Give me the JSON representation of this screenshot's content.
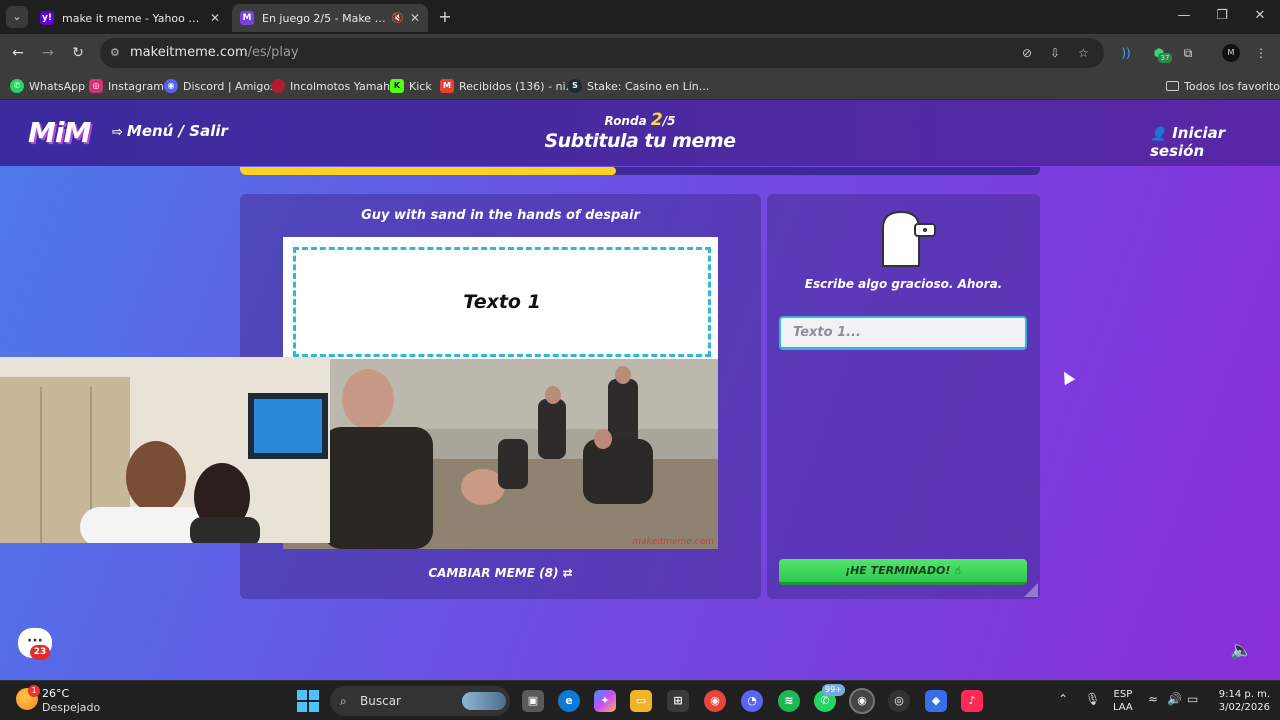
{
  "browser": {
    "tabs": [
      {
        "title": "make it meme - Yahoo Search R",
        "favicon": "yahoo-icon"
      },
      {
        "title": "En juego 2/5 - Make it Meme",
        "favicon": "mim-icon"
      }
    ],
    "url_host": "makeitmeme.com",
    "url_path": "/es/play",
    "bookmarks": [
      {
        "label": "WhatsApp",
        "icon": "whatsapp-icon"
      },
      {
        "label": "Instagram",
        "icon": "instagram-icon"
      },
      {
        "label": "Discord | Amigos",
        "icon": "discord-icon"
      },
      {
        "label": "Incolmotos Yamaha",
        "icon": "yamaha-icon"
      },
      {
        "label": "Kick",
        "icon": "kick-icon"
      },
      {
        "label": "Recibidos (136) - ni...",
        "icon": "gmail-icon"
      },
      {
        "label": "Stake: Casino en Lín...",
        "icon": "stake-icon"
      }
    ],
    "all_bookmarks": "Todos los favoritos",
    "extension_badge": "37"
  },
  "game": {
    "logo": "MiM",
    "menu_exit": "Menú / Salir",
    "round_label": "Ronda",
    "round_current": "2",
    "round_total": "/5",
    "subtitle": "Subtitula tu meme",
    "login": "Iniciar sesión",
    "progress": 0.47,
    "meme_name": "Guy with sand in the hands of despair",
    "text_box_label": "Texto 1",
    "watermark": "makeitmeme.com",
    "change_meme": "CAMBIAR MEME (8)",
    "prompt": "Escribe algo gracioso. Ahora.",
    "input_placeholder": "Texto 1...",
    "done_button": "¡HE TERMINADO!",
    "chat_badge": "23"
  },
  "taskbar": {
    "temperature": "26°C",
    "weather": "Despejado",
    "weather_badge": "1",
    "search_placeholder": "Buscar",
    "whatsapp_badge": "99+",
    "language": "ESP",
    "layout": "LAA",
    "time": "9:14 p. m.",
    "date": "3/02/2026"
  },
  "colors": {
    "accent_yellow": "#ffd21f",
    "done_green": "#2fc94e",
    "dashed_cyan": "#2fb8d8"
  }
}
